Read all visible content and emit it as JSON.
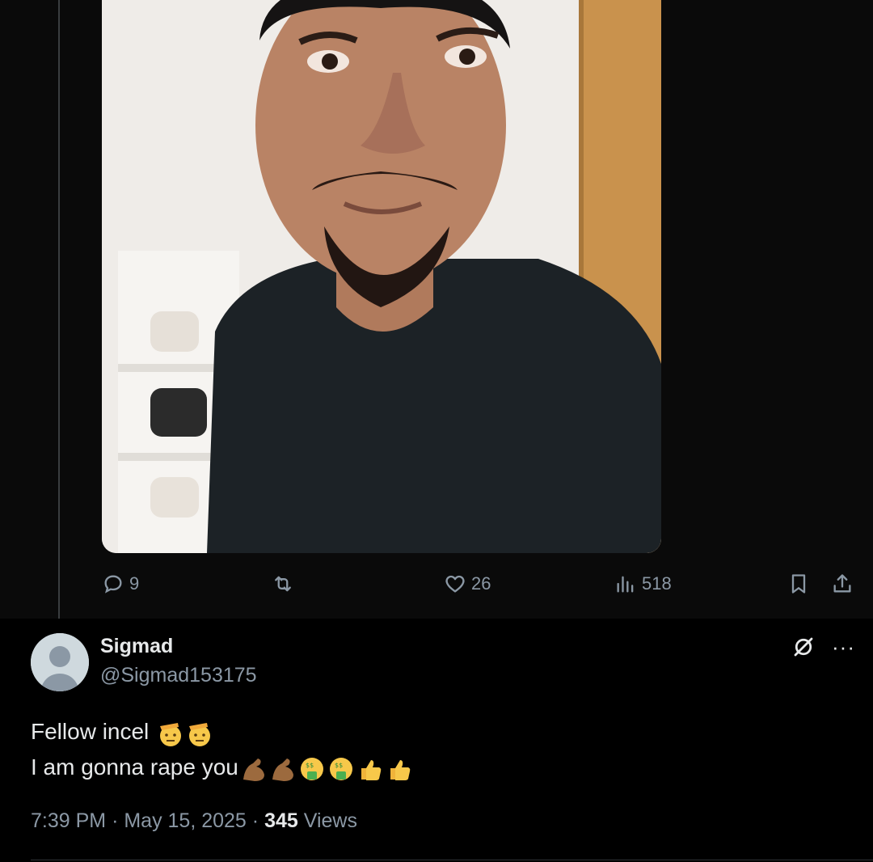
{
  "parent_tweet": {
    "actions": {
      "replies": "9",
      "likes": "26",
      "views": "518"
    }
  },
  "reply": {
    "display_name": "Sigmad",
    "handle": "@Sigmad153175",
    "text_line1": "Fellow incel",
    "text_line2": "I am gonna rape you",
    "time": "7:39 PM",
    "sep1": "·",
    "date": "May 15, 2025",
    "sep2": "·",
    "views_count": "345",
    "views_label": "Views",
    "more_label": "···"
  },
  "icons": {
    "reply": "reply-icon",
    "retweet": "retweet-icon",
    "like": "heart-icon",
    "views": "analytics-icon",
    "bookmark": "bookmark-icon",
    "share": "share-icon",
    "grok": "grok-icon",
    "more": "more-icon"
  },
  "colors": {
    "background": "#000000",
    "text": "#e7e9ea",
    "muted": "#8b98a5",
    "divider": "#2f3336"
  }
}
